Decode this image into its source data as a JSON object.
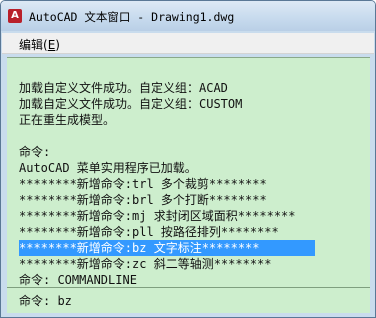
{
  "window": {
    "title": "AutoCAD 文本窗口 - Drawing1.dwg"
  },
  "menu": {
    "items": [
      {
        "label": "编辑",
        "accelerator": "E"
      }
    ]
  },
  "text_window": {
    "lines": [
      "",
      "加载自定义文件成功。自定义组：ACAD",
      "加载自定义文件成功。自定义组：CUSTOM",
      "正在重生成模型。",
      "",
      "命令:",
      "AutoCAD 菜单实用程序已加载。",
      "********新增命令:trl 多个裁剪********",
      "********新增命令:brl 多个打断********",
      "********新增命令:mj 求封闭区域面积********",
      "********新增命令:pll 按路径排列********",
      "********新增命令:bz 文字标注********",
      "********新增命令:zc 斜二等轴测********",
      "命令: COMMANDLINE"
    ],
    "selected_line_index": 11
  },
  "command_input": {
    "value": "命令: bz"
  }
}
